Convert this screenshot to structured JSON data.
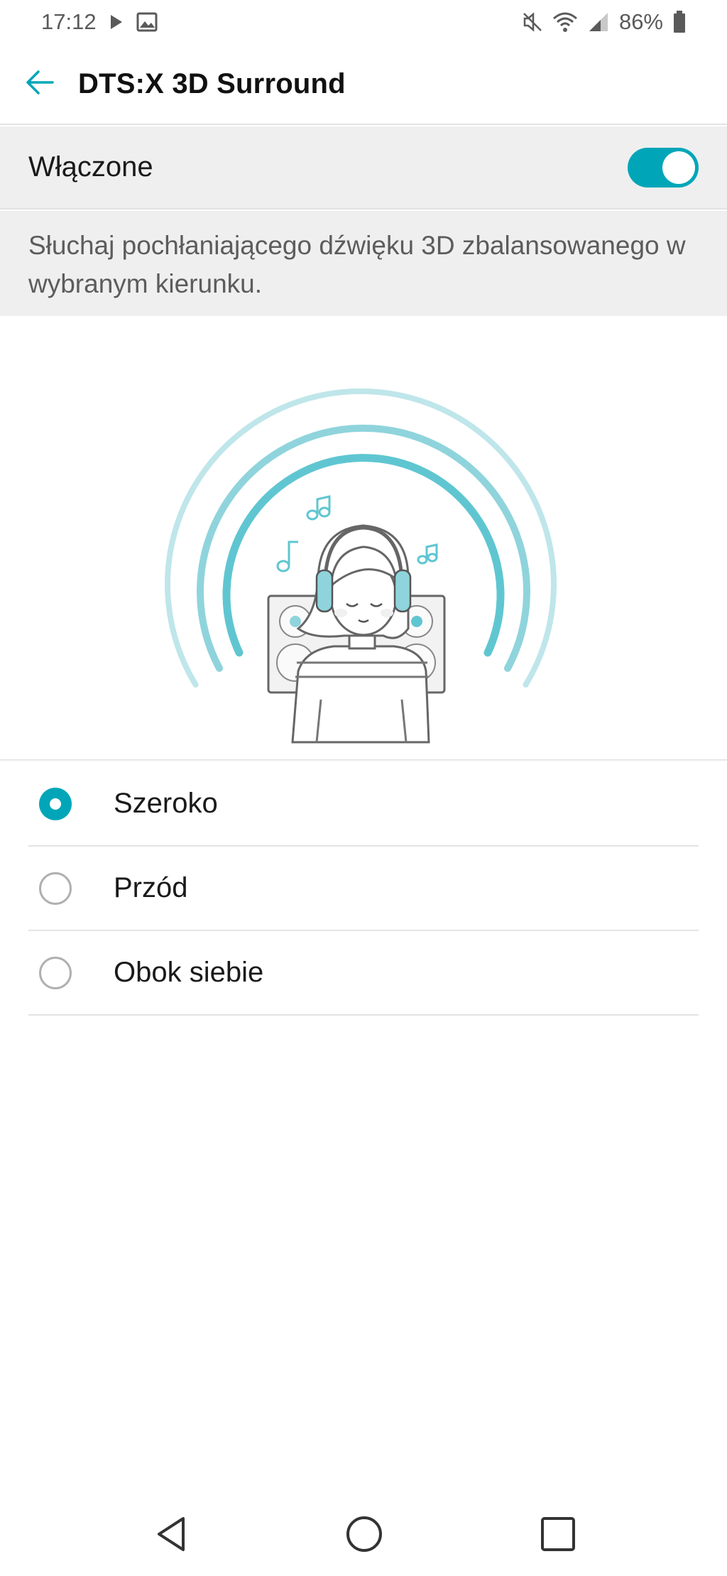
{
  "status_bar": {
    "time": "17:12",
    "battery": "86%",
    "icons": [
      "play-icon",
      "image-icon",
      "mute-icon",
      "wifi-icon",
      "signal-icon",
      "battery-icon"
    ]
  },
  "app_bar": {
    "title": "DTS:X 3D Surround",
    "back_icon": "arrow-left-icon"
  },
  "master_switch": {
    "label": "Włączone",
    "enabled": true
  },
  "description": "Słuchaj pochłaniającego dźwięku 3D zbalansowanego w wybranym kierunku.",
  "illustration": {
    "icon": "listener-headphones-illustration"
  },
  "options": [
    {
      "label": "Szeroko",
      "selected": true
    },
    {
      "label": "Przód",
      "selected": false
    },
    {
      "label": "Obok siebie",
      "selected": false
    }
  ],
  "nav_bar": {
    "icons": [
      "back-icon",
      "home-icon",
      "recents-icon"
    ]
  },
  "colors": {
    "accent": "#00a6b8",
    "arc_light": "#bfe6ea",
    "arc_mid": "#8fd4dc",
    "arc_dark": "#5fc6d1",
    "header_bg": "#efefef"
  }
}
